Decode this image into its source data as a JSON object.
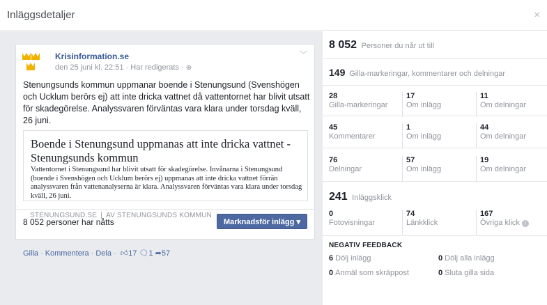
{
  "dialog": {
    "title": "Inläggsdetaljer",
    "close": "×"
  },
  "post": {
    "page_name": "Krisinformation.se",
    "date": "den 25 juni kl. 22:51",
    "edited": "Har redigerats",
    "text": "Stenungsunds kommun uppmanar boende i Stenungsund (Svenshögen och Ucklum berörs ej) att inte dricka vattnet då vattentornet har blivit utsatt för skadegörelse. Analyssvaren förväntas vara klara under torsdag kväll, 26 juni.",
    "link": {
      "title": "Boende i Stenungsund uppmanas att inte dricka vattnet - Stenungsunds kommun",
      "description": "Vattentornet i Stenungsund har blivit utsatt för skadegörelse. Invånarna i Stenungsund (boende i Svenshögen och Ucklum berörs ej) uppmanas att inte dricka vattnet förrän analyssvaren från vattenanalyserna är klara. Analyssvaren förväntas vara klara under torsdag kväll, 26 juni.",
      "domain": "STENUNGSUND.SE",
      "source": "AV STENUNGSUNDS KOMMUN"
    },
    "reach_text": "8 052 personer har nåtts",
    "promote_button": "Marknadsför inlägg",
    "actions": {
      "like": "Gilla",
      "comment": "Kommentera",
      "share": "Dela",
      "likes": "17",
      "comments": "1",
      "shares": "57"
    }
  },
  "insights": {
    "reach": {
      "value": "8 052",
      "label": "Personer du når ut till"
    },
    "engagement": {
      "value": "149",
      "label": "Gilla-markeringar, kommentarer och delningar"
    },
    "rows": [
      {
        "total": "28",
        "total_label": "Gilla-markeringar",
        "on_post": "17",
        "on_post_label": "Om inlägg",
        "on_shares": "11",
        "on_shares_label": "Om delningar"
      },
      {
        "total": "45",
        "total_label": "Kommentarer",
        "on_post": "1",
        "on_post_label": "Om inlägg",
        "on_shares": "44",
        "on_shares_label": "Om delningar"
      },
      {
        "total": "76",
        "total_label": "Delningar",
        "on_post": "57",
        "on_post_label": "Om inlägg",
        "on_shares": "19",
        "on_shares_label": "Om delningar"
      }
    ],
    "clicks": {
      "value": "241",
      "label": "Inläggsklick"
    },
    "click_breakdown": [
      {
        "value": "0",
        "label": "Fotovisningar"
      },
      {
        "value": "74",
        "label": "Länkklick"
      },
      {
        "value": "167",
        "label": "Övriga klick"
      }
    ],
    "negative": {
      "title": "NEGATIV FEEDBACK",
      "items": [
        {
          "value": "6",
          "label": "Dölj inlägg"
        },
        {
          "value": "0",
          "label": "Dölj alla inlägg"
        },
        {
          "value": "0",
          "label": "Anmäl som skräppost"
        },
        {
          "value": "0",
          "label": "Sluta gilla sida"
        }
      ]
    }
  },
  "colors": {
    "link_blue": "#365899",
    "button_blue": "#4e69a2",
    "crown_gold": "#f0b400",
    "left_bg": "#e9ebee"
  }
}
